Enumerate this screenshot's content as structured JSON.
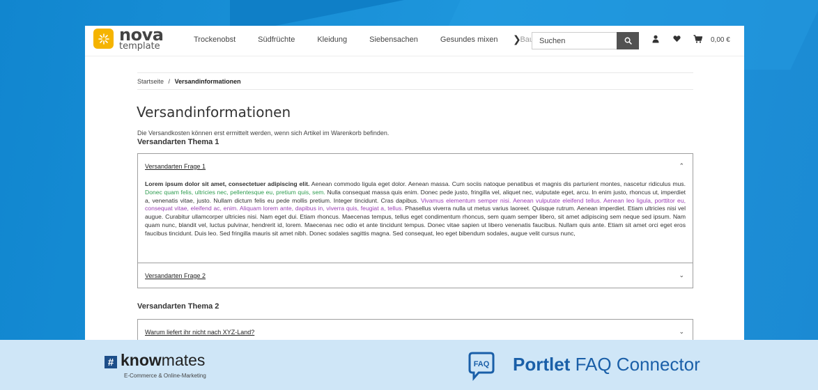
{
  "header": {
    "logo": {
      "line1": "nova",
      "line2": "template"
    },
    "nav": [
      "Trockenobst",
      "Südfrüchte",
      "Kleidung",
      "Siebensachen",
      "Gesundes mixen",
      "Baukast"
    ],
    "search": {
      "placeholder": "Suchen"
    },
    "cart_total": "0,00 €"
  },
  "breadcrumb": {
    "home": "Startseite",
    "separator": "/",
    "current": "Versandinformationen"
  },
  "page": {
    "title": "Versandinformationen",
    "intro": "Die Versandkosten können erst ermittelt werden, wenn sich Artikel im Warenkorb befinden."
  },
  "sections": [
    {
      "title": "Versandarten Thema 1",
      "items": [
        {
          "question": "Versandarten Frage 1",
          "expanded": true,
          "answer": {
            "bold": "Lorem ipsum dolor sit amet, consectetuer adipiscing elit.",
            "p1": " Aenean commodo ligula eget dolor. Aenean massa. Cum sociis natoque penatibus et magnis dis parturient montes, nascetur ridiculus mus. ",
            "green": "Donec quam felis, ultricies nec, pellentesque eu, pretium quis, sem.",
            "p2": " Nulla consequat massa quis enim. Donec pede justo, fringilla vel, aliquet nec, vulputate eget, arcu. In enim justo, rhoncus ut, imperdiet a, venenatis vitae, justo. Nullam dictum felis eu pede mollis pretium. Integer tincidunt. Cras dapibus. ",
            "purple": "Vivamus elementum semper nisi. Aenean vulputate eleifend tellus. Aenean leo ligula, porttitor eu, consequat vitae, eleifend ac, enim. Aliquam lorem ante, dapibus in, viverra quis, feugiat a, tellus.",
            "p3": " Phasellus viverra nulla ut metus varius laoreet. Quisque rutrum. Aenean imperdiet. Etiam ultricies nisi vel augue. Curabitur ullamcorper ultricies nisi. Nam eget dui. Etiam rhoncus. Maecenas tempus, tellus eget condimentum rhoncus, sem quam semper libero, sit amet adipiscing sem neque sed ipsum. Nam quam nunc, blandit vel, luctus pulvinar, hendrerit id, lorem. Maecenas nec odio et ante tincidunt tempus. Donec vitae sapien ut libero venenatis faucibus. Nullam quis ante. Etiam sit amet orci eget eros faucibus tincidunt. Duis leo. Sed fringilla mauris sit amet nibh. Donec sodales sagittis magna. Sed consequat, leo eget bibendum sodales, augue velit cursus nunc,"
          }
        },
        {
          "question": "Versandarten Frage 2",
          "expanded": false
        }
      ]
    },
    {
      "title": "Versandarten Thema 2",
      "items": [
        {
          "question": "Warum liefert ihr nicht nach XYZ-Land?",
          "expanded": false
        }
      ]
    }
  ],
  "footer": {
    "brand_hash": "#",
    "brand_bold": "know",
    "brand_light": "mates",
    "brand_sub": "E-Commerce & Online-Marketing",
    "faq_badge": "FAQ",
    "product_bold": "Portlet",
    "product_rest": " FAQ Connector"
  },
  "colors": {
    "accent_yellow": "#f5b400",
    "bg_blue": "#1a8fd8",
    "footer_bg": "#cfe6f7",
    "brand_blue": "#1a5fa8",
    "green_text": "#2e9c4f",
    "purple_text": "#9a3fb3"
  }
}
